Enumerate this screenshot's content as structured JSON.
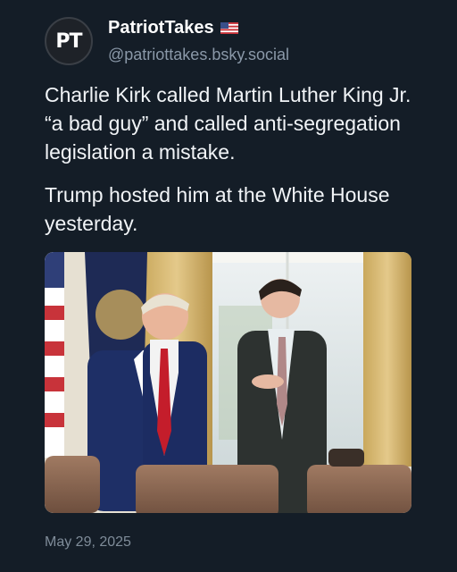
{
  "post": {
    "avatar_text": "PT",
    "display_name": "PatriotTakes",
    "handle": "@patriottakes.bsky.social",
    "paragraphs": [
      "Charlie Kirk called Martin Luther King Jr. “a bad guy” and called anti-segregation legislation a mistake.",
      "Trump hosted him at the White House yesterday."
    ],
    "date": "May 29, 2025"
  },
  "icons": {
    "flag": "us-flag-icon"
  },
  "colors": {
    "background": "#141d27",
    "handle": "#8a98a8",
    "date": "#7f8c99"
  }
}
